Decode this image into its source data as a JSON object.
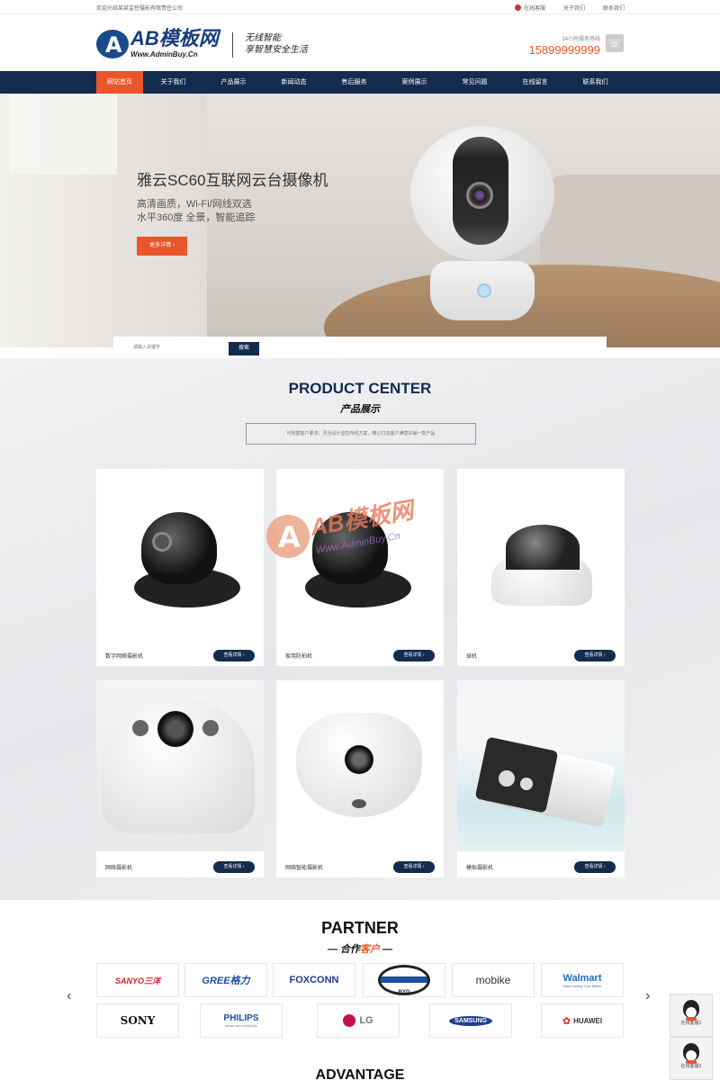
{
  "topbar": {
    "welcome": "欢迎光临某某监控摄影有限责任公司",
    "links": [
      "在线客服",
      "关于我们",
      "联系我们"
    ]
  },
  "header": {
    "logo_title": "AB模板网",
    "logo_sub": "Www.AdminBuy.Cn",
    "slogan_line1": "无线智能",
    "slogan_line2": "享智慧安全生活",
    "hotline_label": "24小时服务热线",
    "hotline_number": "15899999999"
  },
  "nav": {
    "items": [
      "网站首页",
      "关于我们",
      "产品展示",
      "新闻动态",
      "售后服务",
      "案例展示",
      "常见问题",
      "在线留言",
      "联系我们"
    ]
  },
  "banner": {
    "title": "雅云SC60互联网云台摄像机",
    "sub1": "高清画质，Wi-Fi/网线双选",
    "sub2": "水平360度 全景，智能追踪",
    "button": "更多详情 ›"
  },
  "search": {
    "placeholder": "请输入关键字",
    "button": "搜索"
  },
  "products": {
    "title_en": "PRODUCT CENTER",
    "title_cn": "产品展示",
    "desc": "可根据客户要求，灵活设计监控布线方案，精心打造客户满意的每一款产品",
    "more_label": "查看详情 ›",
    "items": [
      {
        "name": "数字网络摄影机"
      },
      {
        "name": "家用防拍机"
      },
      {
        "name": "球机"
      },
      {
        "name": "网络摄影机"
      },
      {
        "name": "网络智能摄影机"
      },
      {
        "name": "模拟摄影机"
      }
    ]
  },
  "watermark": {
    "text": "AB模板网",
    "sub": "Www.AdminBuy.Cn"
  },
  "partner": {
    "title_en": "PARTNER",
    "title_cn_a": "— 合作",
    "title_cn_b": "客户",
    "title_cn_c": " —",
    "logos": [
      "SANYO三洋",
      "GREE格力",
      "FOXCONN",
      "BYD",
      "mobike",
      "Walmart",
      "SONY",
      "PHILIPS",
      "LG",
      "SAMSUNG",
      "HUAWEI"
    ],
    "philips_tagline": "sense and simplicity",
    "walmart_tagline": "Save money. Live better."
  },
  "advantage": {
    "title_en": "ADVANTAGE"
  },
  "float": {
    "qq1": "在线客服1",
    "qq2": "在线客服2"
  }
}
